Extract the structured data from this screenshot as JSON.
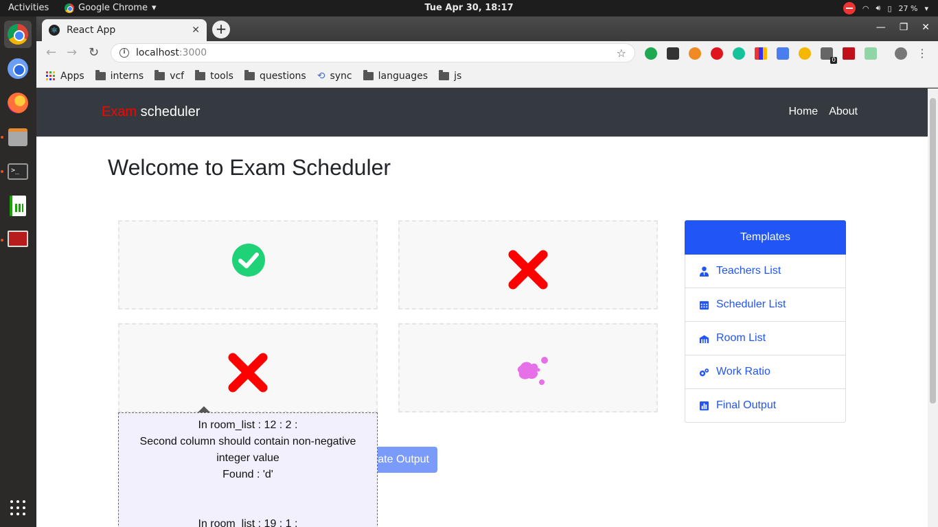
{
  "os": {
    "activities": "Activities",
    "app_name": "Google Chrome",
    "clock": "Tue Apr 30, 18:17",
    "battery": "27 %"
  },
  "browser": {
    "tab_title": "React App",
    "url_host": "localhost",
    "url_port": ":3000",
    "extension_badge": "0",
    "bookmarks": [
      {
        "label": "Apps",
        "icon": "apps-icon"
      },
      {
        "label": "interns",
        "icon": "folder-icon"
      },
      {
        "label": "vcf",
        "icon": "folder-icon"
      },
      {
        "label": "tools",
        "icon": "folder-icon"
      },
      {
        "label": "questions",
        "icon": "folder-icon"
      },
      {
        "label": "sync",
        "icon": "sync-icon"
      },
      {
        "label": "languages",
        "icon": "folder-icon"
      },
      {
        "label": "js",
        "icon": "folder-icon"
      }
    ]
  },
  "app": {
    "brand_highlight": "Exam",
    "brand_rest": " scheduler",
    "nav": {
      "home": "Home",
      "about": "About"
    },
    "heading": "Welcome to Exam Scheduler",
    "generate_button": "Generate Output",
    "dropzones": [
      {
        "status": "success",
        "icon": "check-circle-icon",
        "color": "#1fd278"
      },
      {
        "status": "error",
        "icon": "cross-icon",
        "color": "#ff0000"
      },
      {
        "status": "error",
        "icon": "cross-icon",
        "color": "#ff0000"
      },
      {
        "status": "empty",
        "icon": "splash-icon",
        "color": "#e570e7"
      }
    ],
    "tooltip": {
      "line1": "In room_list : 12 : 2 :",
      "line2": "Second column should contain non-negative",
      "line3": "integer value",
      "line4": "Found : 'd'",
      "line5": "In room_list : 19 : 1 :"
    },
    "templates": {
      "header": "Templates",
      "items": [
        {
          "label": "Teachers List",
          "icon": "user-tie-icon"
        },
        {
          "label": "Scheduler List",
          "icon": "calendar-icon"
        },
        {
          "label": "Room List",
          "icon": "building-icon"
        },
        {
          "label": "Work Ratio",
          "icon": "cogs-icon"
        },
        {
          "label": "Final Output",
          "icon": "chart-bar-icon"
        }
      ]
    },
    "colors": {
      "accent": "#2155f5",
      "navbar": "#343a40",
      "brand": "#ff0000"
    }
  }
}
